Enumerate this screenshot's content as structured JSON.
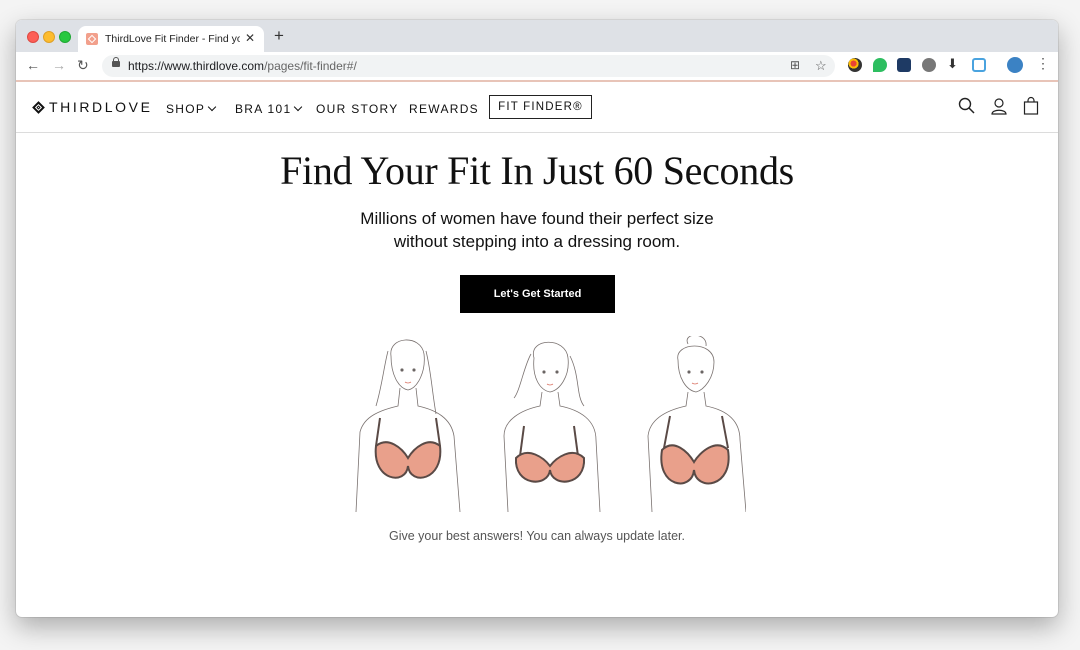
{
  "browser": {
    "tab_title": "ThirdLove Fit Finder - Find your",
    "url_host": "https://www.thirdlove.com",
    "url_path": "/pages/fit-finder#/"
  },
  "site": {
    "logo_text": "THIRDLOVE",
    "nav": {
      "shop": "SHOP",
      "bra101": "BRA 101",
      "our_story": "OUR STORY",
      "rewards": "REWARDS",
      "fit_finder": "FIT FINDER®"
    }
  },
  "hero": {
    "title": "Find Your Fit In Just 60 Seconds",
    "subtitle_line1": "Millions of women have found their perfect size",
    "subtitle_line2": "without stepping into a dressing room.",
    "cta_label": "Let's Get Started",
    "footnote": "Give your best answers! You can always update later."
  },
  "colors": {
    "accent_peach": "#e9a08b",
    "bra_outline": "#5a4a46",
    "cta_bg": "#000000"
  }
}
